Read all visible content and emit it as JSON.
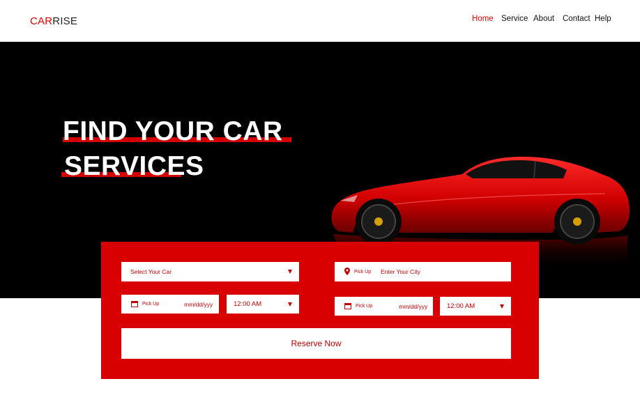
{
  "brand": {
    "part1": "CAR",
    "part2": "RISE"
  },
  "nav": {
    "items": [
      {
        "label": "Home",
        "active": true
      },
      {
        "label": "Service",
        "active": false
      },
      {
        "label": "About",
        "active": false
      },
      {
        "label": "Contact",
        "active": false
      },
      {
        "label": "Help",
        "active": false
      }
    ]
  },
  "hero": {
    "title_line1": "FIND YOUR CAR",
    "title_line2": "SERVICES",
    "accent_color": "#d40000"
  },
  "booking": {
    "car_select": {
      "placeholder": "Select Your Car"
    },
    "pickup_city": {
      "label": "Pick Up",
      "placeholder": "Enter Your City"
    },
    "left_date": {
      "label": "Pick Up",
      "placeholder": "mm/dd/yyy"
    },
    "left_time": {
      "value": "12:00  AM"
    },
    "right_date": {
      "label": "Pick Up",
      "placeholder": "mm/dd/yyy"
    },
    "right_time": {
      "value": "12:00  AM"
    },
    "reserve_label": "Reserve Now",
    "card_color": "#d80000"
  },
  "icons": {
    "location": "location-pin-icon",
    "calendar": "calendar-icon",
    "dropdown": "chevron-down-icon"
  }
}
